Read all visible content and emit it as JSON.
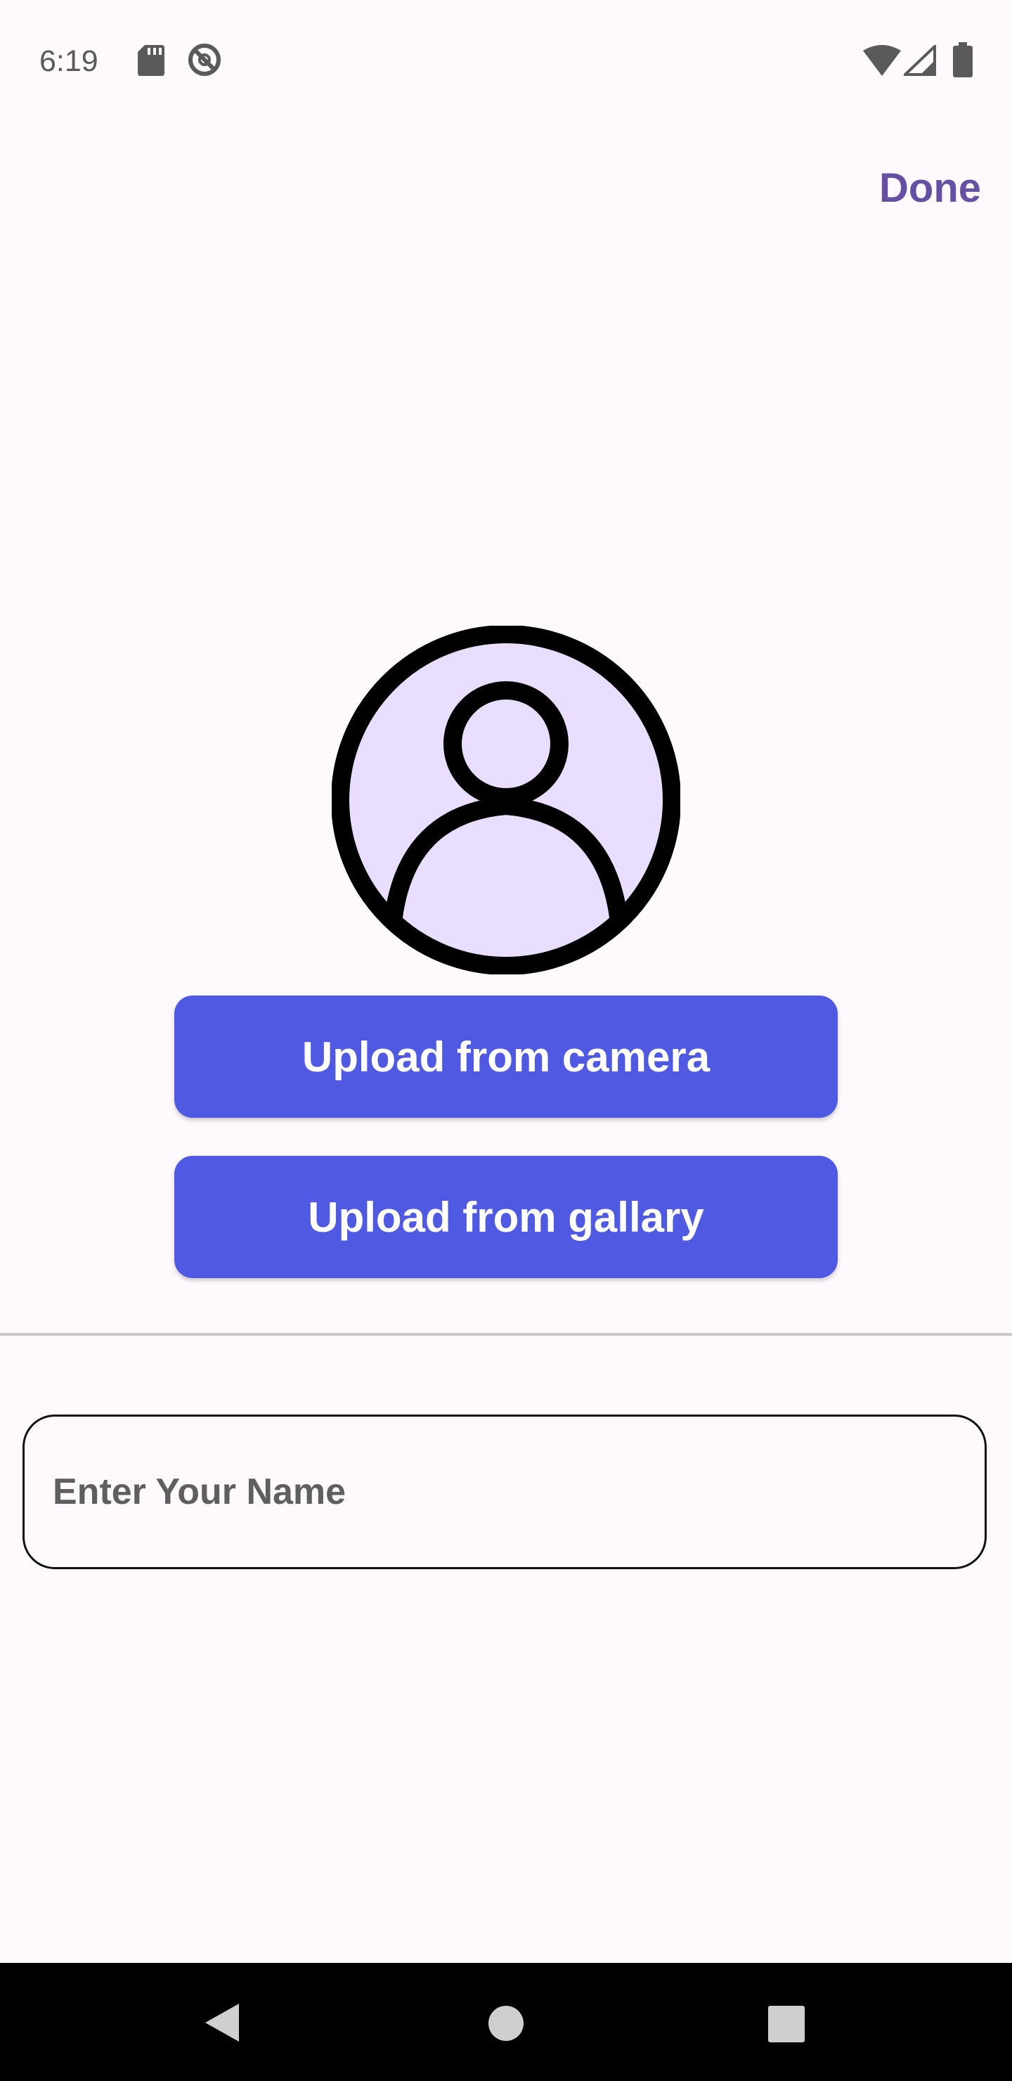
{
  "status_bar": {
    "time": "6:19",
    "icons": [
      "sd-card-icon",
      "no-sync-icon",
      "wifi-icon",
      "cell-signal-icon",
      "battery-icon"
    ]
  },
  "header": {
    "done_label": "Done"
  },
  "profile": {
    "avatar_icon": "account-circle-icon",
    "avatar_fill": "#E9DEFD"
  },
  "actions": {
    "camera_label": "Upload from camera",
    "gallery_label": "Upload from gallary"
  },
  "form": {
    "name_placeholder": "Enter Your Name",
    "name_value": ""
  },
  "navigation": {
    "icons": [
      "back-icon",
      "home-icon",
      "recents-icon"
    ]
  },
  "colors": {
    "accent": "#6650A4",
    "button": "#5059E2",
    "background": "#FEF9FD"
  }
}
